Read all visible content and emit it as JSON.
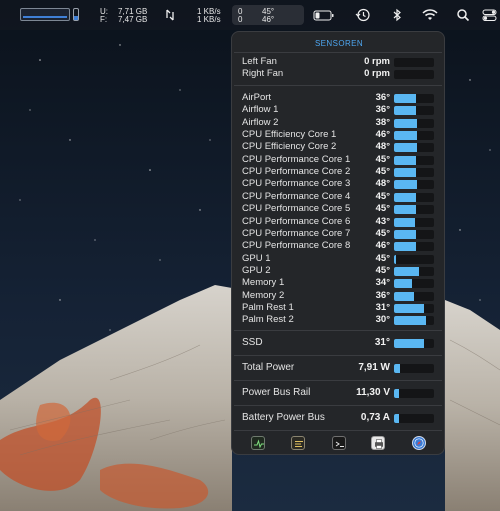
{
  "menubar": {
    "memory": {
      "used_label": "U:",
      "used_value": "7,71 GB",
      "free_label": "F:",
      "free_value": "7,47 GB"
    },
    "network": {
      "up": "1 KB/s",
      "down": "1 KB/s"
    },
    "sensors": {
      "top_left": "0",
      "top_right": "45°",
      "bottom_left": "0",
      "bottom_right": "46°"
    },
    "icons": [
      "arrows-icon",
      "battery-icon",
      "time-machine-icon",
      "bluetooth-icon",
      "wifi-icon",
      "search-icon",
      "control-center-icon"
    ]
  },
  "panel": {
    "title": "SENSOREN",
    "fans": [
      {
        "label": "Left Fan",
        "value": "0 rpm",
        "level": 0
      },
      {
        "label": "Right Fan",
        "value": "0 rpm",
        "level": 0
      }
    ],
    "temps": [
      {
        "label": "AirPort",
        "value": "36°",
        "level": 0.55
      },
      {
        "label": "Airflow 1",
        "value": "36°",
        "level": 0.55
      },
      {
        "label": "Airflow 2",
        "value": "38°",
        "level": 0.58
      },
      {
        "label": "CPU Efficiency Core 1",
        "value": "46°",
        "level": 0.58
      },
      {
        "label": "CPU Efficiency Core 2",
        "value": "48°",
        "level": 0.58
      },
      {
        "label": "CPU Performance Core 1",
        "value": "45°",
        "level": 0.55
      },
      {
        "label": "CPU Performance Core 2",
        "value": "45°",
        "level": 0.55
      },
      {
        "label": "CPU Performance Core 3",
        "value": "48°",
        "level": 0.58
      },
      {
        "label": "CPU Performance Core 4",
        "value": "45°",
        "level": 0.55
      },
      {
        "label": "CPU Performance Core 5",
        "value": "45°",
        "level": 0.55
      },
      {
        "label": "CPU Performance Core 6",
        "value": "43°",
        "level": 0.52
      },
      {
        "label": "CPU Performance Core 7",
        "value": "45°",
        "level": 0.55
      },
      {
        "label": "CPU Performance Core 8",
        "value": "46°",
        "level": 0.55
      },
      {
        "label": "GPU 1",
        "value": "45°",
        "level": 0.05
      },
      {
        "label": "GPU 2",
        "value": "45°",
        "level": 0.62
      },
      {
        "label": "Memory 1",
        "value": "34°",
        "level": 0.45
      },
      {
        "label": "Memory 2",
        "value": "36°",
        "level": 0.5
      },
      {
        "label": "Palm Rest 1",
        "value": "31°",
        "level": 0.75
      },
      {
        "label": "Palm Rest 2",
        "value": "30°",
        "level": 0.8
      }
    ],
    "ssd": {
      "label": "SSD",
      "value": "31°",
      "level": 0.75
    },
    "power": {
      "label": "Total Power",
      "value": "7,91 W",
      "level": 0.15
    },
    "voltage": {
      "label": "Power Bus Rail",
      "value": "11,30 V",
      "level": 0.12
    },
    "current": {
      "label": "Battery Power Bus",
      "value": "0,73 A",
      "level": 0.12
    },
    "toolbar": [
      "activity-monitor-icon",
      "console-icon",
      "terminal-icon",
      "printer-icon",
      "safari-icon"
    ]
  },
  "colors": {
    "accent": "#4ea6f0",
    "bar": "#5ab7f2",
    "panel": "#242629"
  }
}
